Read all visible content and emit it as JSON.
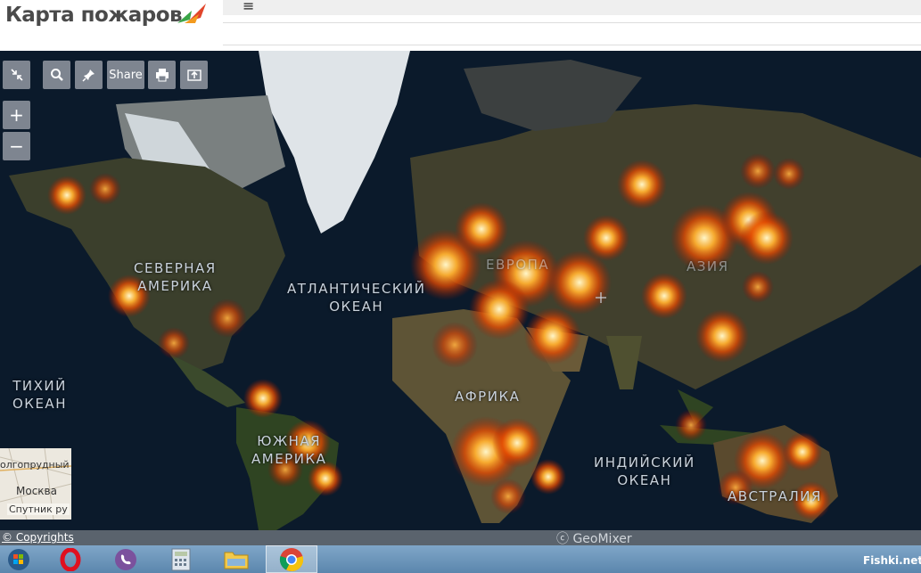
{
  "app": {
    "title": "Карта пожаров",
    "menu_icon": "≡"
  },
  "toolbar": {
    "collapse_icon": "collapse-arrows-icon",
    "search_icon": "search-icon",
    "pin_icon": "pin-icon",
    "share_label": "Share",
    "print_icon": "print-icon",
    "export_icon": "export-icon",
    "zoom_in": "+",
    "zoom_out": "−"
  },
  "map": {
    "labels": {
      "north_america_1": "СЕВЕРНАЯ",
      "north_america_2": "АМЕРИКА",
      "atlantic_1": "АТЛАНТИЧЕСКИЙ",
      "atlantic_2": "ОКЕАН",
      "pacific_1": "ТИХИЙ",
      "pacific_2": "ОКЕАН",
      "africa": "АФРИКА",
      "south_america_1": "ЮЖНАЯ",
      "south_america_2": "АМЕРИКА",
      "indian_1": "ИНДИЙСКИЙ",
      "indian_2": "ОКЕАН",
      "australia": "АВСТРАЛИЯ",
      "europe": "ЕВРОПА",
      "asia": "АЗИЯ"
    },
    "minimap": {
      "top_text": "олгопрудный",
      "city": "Москва",
      "layer": "Спутник ру"
    },
    "copyright": "© Copyrights",
    "provider": "ⓒ GeoMixer",
    "colors": {
      "fire_core": "#fff4c0",
      "fire_mid": "#ff8a10",
      "fire_outer": "#c82800",
      "ocean": "#0b1a2b",
      "land": "#3a3f2a",
      "ice": "#e8ecef"
    }
  },
  "taskbar": {
    "apps": [
      "windows-start-icon",
      "opera-icon",
      "viber-icon",
      "calculator-icon",
      "file-explorer-icon",
      "chrome-icon"
    ],
    "watermark": "Fishki.net"
  }
}
